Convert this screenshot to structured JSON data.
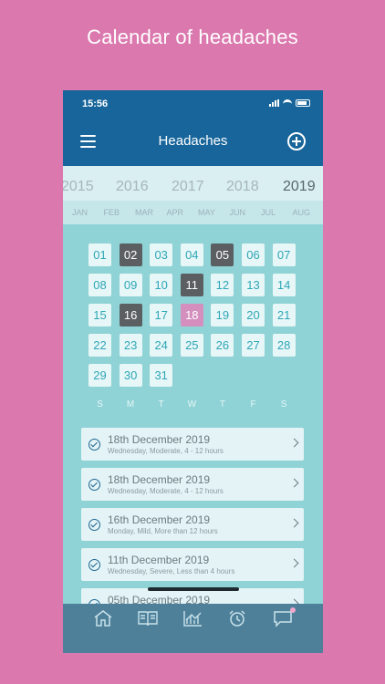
{
  "caption": "Calendar of headaches",
  "status_bar": {
    "time": "15:56"
  },
  "nav": {
    "title": "Headaches"
  },
  "years": [
    "2015",
    "2016",
    "2017",
    "2018",
    "2019"
  ],
  "selected_year": "2019",
  "months": [
    "JAN",
    "FEB",
    "MAR",
    "APR",
    "MAY",
    "JUN",
    "JUL",
    "AUG"
  ],
  "days": [
    "01",
    "02",
    "03",
    "04",
    "05",
    "06",
    "07",
    "08",
    "09",
    "10",
    "11",
    "12",
    "13",
    "14",
    "15",
    "16",
    "17",
    "18",
    "19",
    "20",
    "21",
    "22",
    "23",
    "24",
    "25",
    "26",
    "27",
    "28",
    "29",
    "30",
    "31"
  ],
  "headache_days": [
    "02",
    "05",
    "11",
    "16"
  ],
  "today": "18",
  "weekdays": [
    "S",
    "M",
    "T",
    "W",
    "T",
    "F",
    "S"
  ],
  "entries": [
    {
      "title": "18th December 2019",
      "sub": "Wednesday, Moderate, 4 - 12 hours"
    },
    {
      "title": "18th December 2019",
      "sub": "Wednesday, Moderate, 4 - 12 hours"
    },
    {
      "title": "16th December 2019",
      "sub": "Monday, Mild, More than 12 hours"
    },
    {
      "title": "11th December 2019",
      "sub": "Wednesday, Severe, Less than 4 hours"
    },
    {
      "title": "05th December 2019",
      "sub": ""
    }
  ],
  "tabs": [
    "home-icon",
    "diary-icon",
    "stats-icon",
    "alarm-icon",
    "messages-icon"
  ],
  "colors": {
    "background": "#db78ae",
    "brand": "#17659a",
    "headache": "#5b5f62",
    "today": "#d58fbf",
    "day": "#e7f6f7"
  }
}
